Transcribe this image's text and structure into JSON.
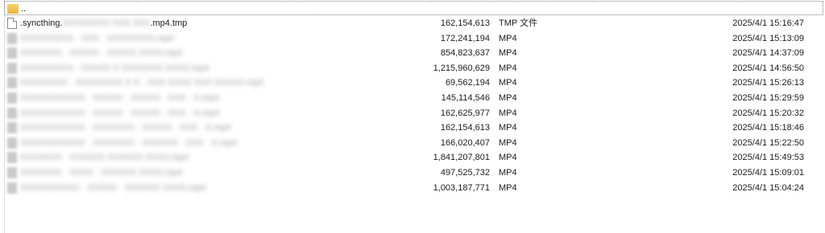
{
  "parent_row": {
    "label": ".."
  },
  "rows": [
    {
      "name_prefix": ".syncthing.",
      "name_hidden": "XXXXXXXX XXX XXX",
      "name_suffix": ".mp4.tmp",
      "size": "162,154,613",
      "type": "TMP 文件",
      "modified": "2025/4/1 15:16:47"
    },
    {
      "name_hidden": "XXXXXXXXX · XXX · XXXXXXXX.mp4",
      "size": "172,241,194",
      "type": "MP4",
      "modified": "2025/4/1 15:13:09"
    },
    {
      "name_hidden": "XXXXXXX · XXXXX · XXXXX XXXX.mp4",
      "size": "854,823,637",
      "type": "MP4",
      "modified": "2025/4/1 14:37:09"
    },
    {
      "name_hidden": "XXXXXXXXX · XXXXX X XXXXXXX XXXX.mp4",
      "size": "1,215,960,629",
      "type": "MP4",
      "modified": "2025/4/1 14:56:50"
    },
    {
      "name_hidden": "XXXXXXXX · XXXXXXXX X·X · XXX XXXX XXX XXXXX.mp4",
      "size": "69,562,194",
      "type": "MP4",
      "modified": "2025/4/1 15:26:13"
    },
    {
      "name_hidden": "XXXXXXXXXXX · XXXXX · XXXXX · XXX · X.mp4",
      "size": "145,114,546",
      "type": "MP4",
      "modified": "2025/4/1 15:29:59"
    },
    {
      "name_hidden": "XXXXXXXXXXX · XXXXX · XXXXX · XXX · X.mp4",
      "size": "162,625,977",
      "type": "MP4",
      "modified": "2025/4/1 15:20:32"
    },
    {
      "name_hidden": "XXXXXXXXXXX · XXXXXXX · XXXXX · XXX · X.mp4",
      "size": "162,154,613",
      "type": "MP4",
      "modified": "2025/4/1 15:18:46"
    },
    {
      "name_hidden": "XXXXXXXXXXX · XXXXXXX · XXXXXX · XXX · X.mp4",
      "size": "166,020,407",
      "type": "MP4",
      "modified": "2025/4/1 15:22:50"
    },
    {
      "name_hidden": "XXXXXXX · XXXXXX XXXXXX XXXX.mp4",
      "size": "1,841,207,801",
      "type": "MP4",
      "modified": "2025/4/1 15:49:53"
    },
    {
      "name_hidden": "XXXXXXX · XXXX · XXXXXX XXXX.mp4",
      "size": "497,525,732",
      "type": "MP4",
      "modified": "2025/4/1 15:09:01"
    },
    {
      "name_hidden": "XXXXXXXXXX · XXXXX · XXXXXX XXXX.mp4",
      "size": "1,003,187,771",
      "type": "MP4",
      "modified": "2025/4/1 15:04:24"
    }
  ]
}
